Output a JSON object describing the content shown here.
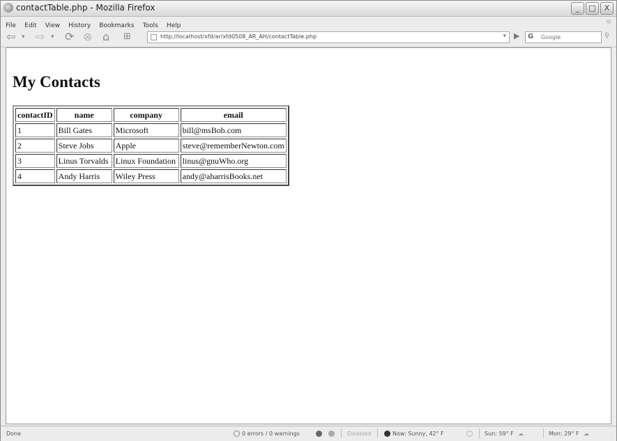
{
  "window": {
    "title": "contactTable.php - Mozilla Firefox",
    "minimize": "_",
    "maximize": "□",
    "close": "X"
  },
  "menu": [
    "File",
    "Edit",
    "View",
    "History",
    "Bookmarks",
    "Tools",
    "Help"
  ],
  "nav": {
    "url": "http://localhost/xfd/ar/xfd0508_AR_AH/contactTable.php",
    "search_engine": "G",
    "search_placeholder": "Google"
  },
  "page": {
    "heading": "My Contacts",
    "table": {
      "headers": [
        "contactID",
        "name",
        "company",
        "email"
      ],
      "rows": [
        [
          "1",
          "Bill Gates",
          "Microsoft",
          "bill@msBob.com"
        ],
        [
          "2",
          "Steve Jobs",
          "Apple",
          "steve@rememberNewton.com"
        ],
        [
          "3",
          "Linus Torvalds",
          "Linux Foundation",
          "linus@gnuWho.org"
        ],
        [
          "4",
          "Andy Harris",
          "Wiley Press",
          "andy@aharrisBooks.net"
        ]
      ]
    }
  },
  "status": {
    "text": "Done",
    "errors": "0 errors / 0 warnings",
    "disabled": "Disabled",
    "weather_now": "Now: Sunny, 42° F",
    "weather_sun": "Sun: 59° F",
    "weather_mon": "Mon: 29° F"
  }
}
